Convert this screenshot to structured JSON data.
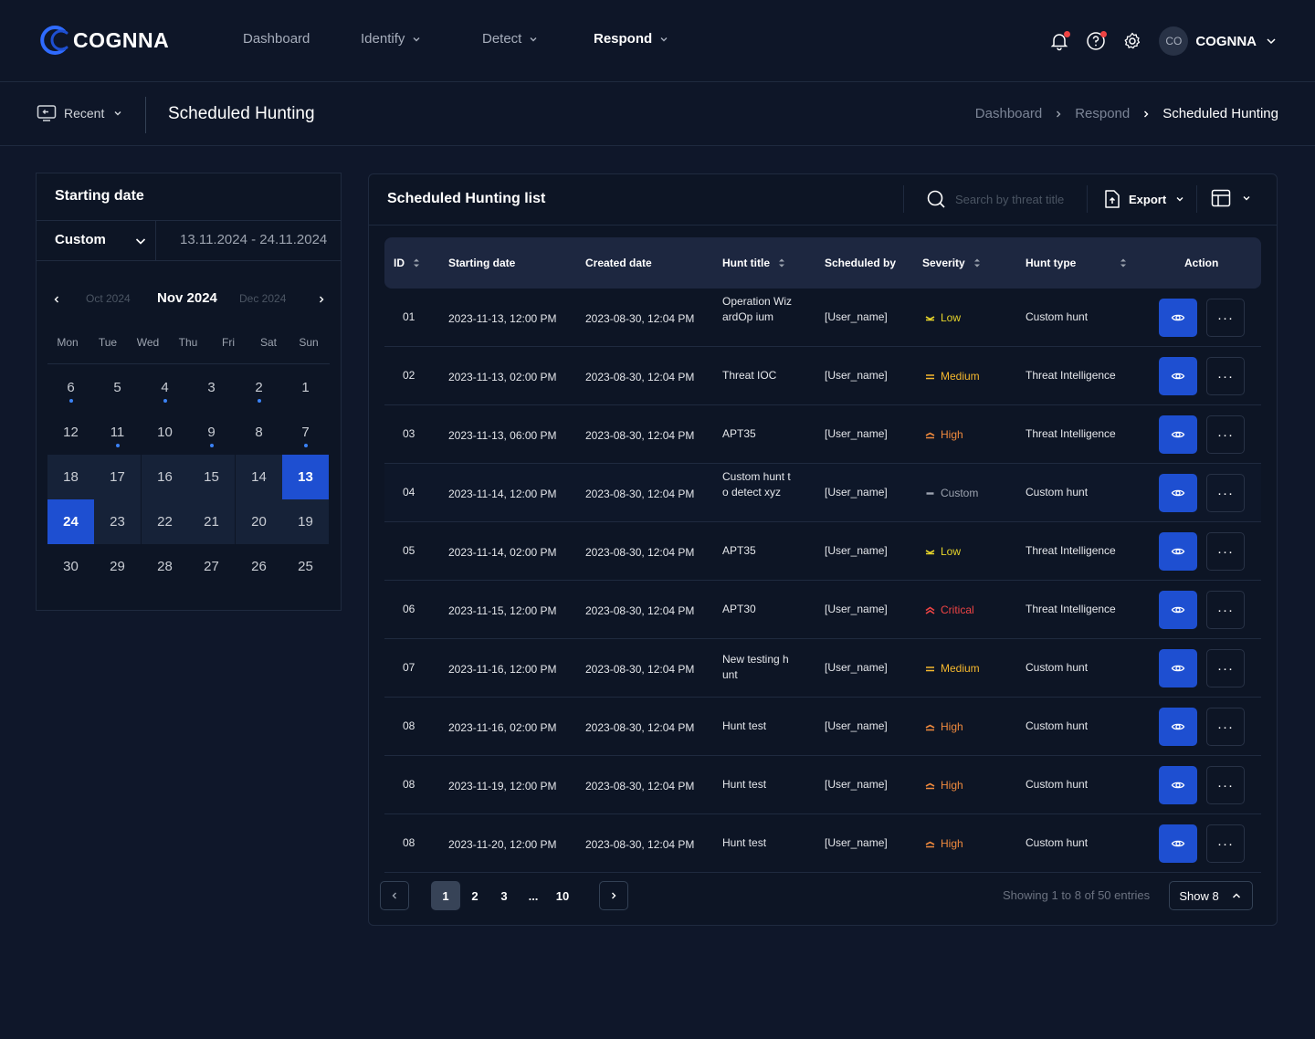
{
  "brand": {
    "name": "COGNNA"
  },
  "nav": [
    {
      "label": "Dashboard",
      "dropdown": false,
      "active": false
    },
    {
      "label": "Identify",
      "dropdown": true,
      "active": false
    },
    {
      "label": "Detect",
      "dropdown": true,
      "active": false
    },
    {
      "label": "Respond",
      "dropdown": true,
      "active": true
    }
  ],
  "user": {
    "initials": "CO",
    "name": "COGNNA"
  },
  "subbar": {
    "recent_label": "Recent",
    "page_title": "Scheduled Hunting",
    "breadcrumb": [
      "Dashboard",
      "Respond",
      "Scheduled Hunting"
    ]
  },
  "date_panel": {
    "title": "Starting date",
    "mode": "Custom",
    "range": "13.11.2024 - 24.11.2024",
    "prev_month": "Oct 2024",
    "current_month": "Nov 2024",
    "next_month": "Dec 2024",
    "weekdays": [
      "Mon",
      "Tue",
      "Wed",
      "Thu",
      "Fri",
      "Sat",
      "Sun"
    ],
    "weeks": [
      [
        "6",
        "5",
        "4",
        "3",
        "2",
        "1"
      ],
      [
        "12",
        "11",
        "10",
        "9",
        "8",
        "7"
      ],
      [
        "18",
        "17",
        "16",
        "15",
        "14",
        "13"
      ],
      [
        "24",
        "23",
        "22",
        "21",
        "20",
        "19"
      ],
      [
        "30",
        "29",
        "28",
        "27",
        "26",
        "25"
      ]
    ],
    "event_days": [
      "6",
      "4",
      "2",
      "11",
      "9",
      "7"
    ],
    "selected_days": [
      "13",
      "24"
    ],
    "range_days": [
      "18",
      "17",
      "16",
      "15",
      "14",
      "23",
      "22",
      "21",
      "20",
      "19"
    ]
  },
  "list": {
    "title": "Scheduled Hunting list",
    "search_placeholder": "Search by threat title",
    "export_label": "Export",
    "columns": [
      "ID",
      "Starting date",
      "Created date",
      "Hunt title",
      "Scheduled by",
      "Severity",
      "Hunt type",
      "Action"
    ],
    "rows": [
      {
        "id": "01",
        "start": "2023-11-13, 12:00 PM",
        "created": "2023-08-30, 12:04 PM",
        "title": "Operation WizardOp ium",
        "by": "[User_name]",
        "severity": "Low",
        "type": "Custom hunt"
      },
      {
        "id": "02",
        "start": "2023-11-13, 02:00 PM",
        "created": "2023-08-30, 12:04 PM",
        "title": "Threat IOC",
        "by": "[User_name]",
        "severity": "Medium",
        "type": "Threat Intelligence"
      },
      {
        "id": "03",
        "start": "2023-11-13, 06:00 PM",
        "created": "2023-08-30, 12:04 PM",
        "title": "APT35",
        "by": "[User_name]",
        "severity": "High",
        "type": "Threat Intelligence"
      },
      {
        "id": "04",
        "start": "2023-11-14, 12:00 PM",
        "created": "2023-08-30, 12:04 PM",
        "title": "Custom hunt to detect xyz",
        "by": "[User_name]",
        "severity": "Custom",
        "type": "Custom hunt"
      },
      {
        "id": "05",
        "start": "2023-11-14, 02:00 PM",
        "created": "2023-08-30, 12:04 PM",
        "title": "APT35",
        "by": "[User_name]",
        "severity": "Low",
        "type": "Threat Intelligence"
      },
      {
        "id": "06",
        "start": "2023-11-15, 12:00 PM",
        "created": "2023-08-30, 12:04 PM",
        "title": "APT30",
        "by": "[User_name]",
        "severity": "Critical",
        "type": "Threat Intelligence"
      },
      {
        "id": "07",
        "start": "2023-11-16, 12:00 PM",
        "created": "2023-08-30, 12:04 PM",
        "title": "New testing hunt",
        "by": "[User_name]",
        "severity": "Medium",
        "type": "Custom hunt"
      },
      {
        "id": "08",
        "start": "2023-11-16, 02:00 PM",
        "created": "2023-08-30, 12:04 PM",
        "title": "Hunt test",
        "by": "[User_name]",
        "severity": "High",
        "type": "Custom hunt"
      },
      {
        "id": "08",
        "start": "2023-11-19, 12:00 PM",
        "created": "2023-08-30, 12:04 PM",
        "title": "Hunt test",
        "by": "[User_name]",
        "severity": "High",
        "type": "Custom hunt"
      },
      {
        "id": "08",
        "start": "2023-11-20, 12:00 PM",
        "created": "2023-08-30, 12:04 PM",
        "title": "Hunt test",
        "by": "[User_name]",
        "severity": "High",
        "type": "Custom hunt"
      }
    ],
    "more_label": "···"
  },
  "pagination": {
    "pages": [
      "1",
      "2",
      "3",
      "...",
      "10"
    ],
    "active_page": "1",
    "showing": "Showing 1 to 8 of 50 entries",
    "show_label": "Show 8"
  },
  "severity_colors": {
    "Low": "#e5d32a",
    "Medium": "#f5b82e",
    "High": "#f08a3e",
    "Custom": "#9ca3af",
    "Critical": "#ef4444"
  },
  "colors": {
    "accent": "#1e4fd1",
    "background": "#0f172a"
  }
}
